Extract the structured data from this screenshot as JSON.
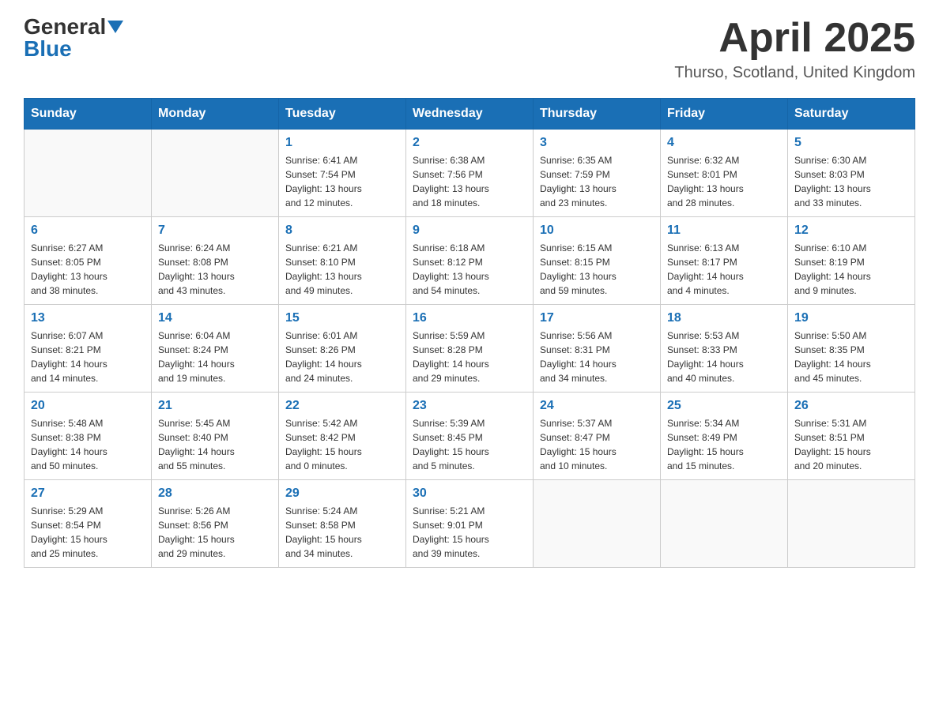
{
  "header": {
    "logo_general": "General",
    "logo_blue": "Blue",
    "month_title": "April 2025",
    "location": "Thurso, Scotland, United Kingdom"
  },
  "weekdays": [
    "Sunday",
    "Monday",
    "Tuesday",
    "Wednesday",
    "Thursday",
    "Friday",
    "Saturday"
  ],
  "weeks": [
    [
      {
        "day": "",
        "detail": ""
      },
      {
        "day": "",
        "detail": ""
      },
      {
        "day": "1",
        "detail": "Sunrise: 6:41 AM\nSunset: 7:54 PM\nDaylight: 13 hours\nand 12 minutes."
      },
      {
        "day": "2",
        "detail": "Sunrise: 6:38 AM\nSunset: 7:56 PM\nDaylight: 13 hours\nand 18 minutes."
      },
      {
        "day": "3",
        "detail": "Sunrise: 6:35 AM\nSunset: 7:59 PM\nDaylight: 13 hours\nand 23 minutes."
      },
      {
        "day": "4",
        "detail": "Sunrise: 6:32 AM\nSunset: 8:01 PM\nDaylight: 13 hours\nand 28 minutes."
      },
      {
        "day": "5",
        "detail": "Sunrise: 6:30 AM\nSunset: 8:03 PM\nDaylight: 13 hours\nand 33 minutes."
      }
    ],
    [
      {
        "day": "6",
        "detail": "Sunrise: 6:27 AM\nSunset: 8:05 PM\nDaylight: 13 hours\nand 38 minutes."
      },
      {
        "day": "7",
        "detail": "Sunrise: 6:24 AM\nSunset: 8:08 PM\nDaylight: 13 hours\nand 43 minutes."
      },
      {
        "day": "8",
        "detail": "Sunrise: 6:21 AM\nSunset: 8:10 PM\nDaylight: 13 hours\nand 49 minutes."
      },
      {
        "day": "9",
        "detail": "Sunrise: 6:18 AM\nSunset: 8:12 PM\nDaylight: 13 hours\nand 54 minutes."
      },
      {
        "day": "10",
        "detail": "Sunrise: 6:15 AM\nSunset: 8:15 PM\nDaylight: 13 hours\nand 59 minutes."
      },
      {
        "day": "11",
        "detail": "Sunrise: 6:13 AM\nSunset: 8:17 PM\nDaylight: 14 hours\nand 4 minutes."
      },
      {
        "day": "12",
        "detail": "Sunrise: 6:10 AM\nSunset: 8:19 PM\nDaylight: 14 hours\nand 9 minutes."
      }
    ],
    [
      {
        "day": "13",
        "detail": "Sunrise: 6:07 AM\nSunset: 8:21 PM\nDaylight: 14 hours\nand 14 minutes."
      },
      {
        "day": "14",
        "detail": "Sunrise: 6:04 AM\nSunset: 8:24 PM\nDaylight: 14 hours\nand 19 minutes."
      },
      {
        "day": "15",
        "detail": "Sunrise: 6:01 AM\nSunset: 8:26 PM\nDaylight: 14 hours\nand 24 minutes."
      },
      {
        "day": "16",
        "detail": "Sunrise: 5:59 AM\nSunset: 8:28 PM\nDaylight: 14 hours\nand 29 minutes."
      },
      {
        "day": "17",
        "detail": "Sunrise: 5:56 AM\nSunset: 8:31 PM\nDaylight: 14 hours\nand 34 minutes."
      },
      {
        "day": "18",
        "detail": "Sunrise: 5:53 AM\nSunset: 8:33 PM\nDaylight: 14 hours\nand 40 minutes."
      },
      {
        "day": "19",
        "detail": "Sunrise: 5:50 AM\nSunset: 8:35 PM\nDaylight: 14 hours\nand 45 minutes."
      }
    ],
    [
      {
        "day": "20",
        "detail": "Sunrise: 5:48 AM\nSunset: 8:38 PM\nDaylight: 14 hours\nand 50 minutes."
      },
      {
        "day": "21",
        "detail": "Sunrise: 5:45 AM\nSunset: 8:40 PM\nDaylight: 14 hours\nand 55 minutes."
      },
      {
        "day": "22",
        "detail": "Sunrise: 5:42 AM\nSunset: 8:42 PM\nDaylight: 15 hours\nand 0 minutes."
      },
      {
        "day": "23",
        "detail": "Sunrise: 5:39 AM\nSunset: 8:45 PM\nDaylight: 15 hours\nand 5 minutes."
      },
      {
        "day": "24",
        "detail": "Sunrise: 5:37 AM\nSunset: 8:47 PM\nDaylight: 15 hours\nand 10 minutes."
      },
      {
        "day": "25",
        "detail": "Sunrise: 5:34 AM\nSunset: 8:49 PM\nDaylight: 15 hours\nand 15 minutes."
      },
      {
        "day": "26",
        "detail": "Sunrise: 5:31 AM\nSunset: 8:51 PM\nDaylight: 15 hours\nand 20 minutes."
      }
    ],
    [
      {
        "day": "27",
        "detail": "Sunrise: 5:29 AM\nSunset: 8:54 PM\nDaylight: 15 hours\nand 25 minutes."
      },
      {
        "day": "28",
        "detail": "Sunrise: 5:26 AM\nSunset: 8:56 PM\nDaylight: 15 hours\nand 29 minutes."
      },
      {
        "day": "29",
        "detail": "Sunrise: 5:24 AM\nSunset: 8:58 PM\nDaylight: 15 hours\nand 34 minutes."
      },
      {
        "day": "30",
        "detail": "Sunrise: 5:21 AM\nSunset: 9:01 PM\nDaylight: 15 hours\nand 39 minutes."
      },
      {
        "day": "",
        "detail": ""
      },
      {
        "day": "",
        "detail": ""
      },
      {
        "day": "",
        "detail": ""
      }
    ]
  ]
}
